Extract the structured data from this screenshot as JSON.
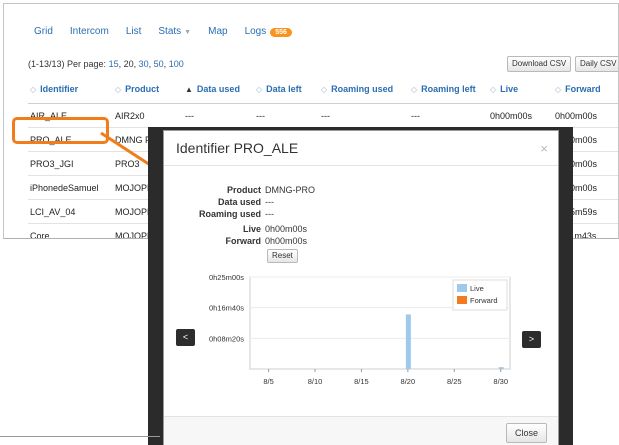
{
  "nav": {
    "grid": "Grid",
    "intercom": "Intercom",
    "list": "List",
    "stats": "Stats",
    "map": "Map",
    "logs": "Logs",
    "logs_count": "556"
  },
  "paging": {
    "summary": "(1-13/13) Per page: ",
    "options": [
      "15",
      "20",
      "30",
      "50",
      "100"
    ],
    "selected": "20"
  },
  "buttons": {
    "download_csv": "Download CSV",
    "daily_csv": "Daily CSV"
  },
  "table": {
    "headers": [
      "Identifier",
      "Product",
      "Data used",
      "Data left",
      "Roaming used",
      "Roaming left",
      "Live",
      "Forward"
    ],
    "rows": [
      [
        "AIR_ALE",
        "AIR2x0",
        "---",
        "---",
        "---",
        "---",
        "0h00m00s",
        "0h00m00s"
      ],
      [
        "PRO_ALE",
        "DMNG PRO",
        "",
        "",
        "",
        "",
        "0h00m00s",
        "0h00m00s"
      ],
      [
        "PRO3_JGI",
        "PRO3",
        "",
        "",
        "",
        "",
        "0h00m00s",
        "0h00m00s"
      ],
      [
        "iPhonedeSamuel",
        "MOJOPRO",
        "",
        "",
        "",
        "",
        "0h00m00s",
        "0h00m00s"
      ],
      [
        "LCI_AV_04",
        "MOJOPRO",
        "",
        "",
        "",
        "",
        "0h55m59s",
        "0h55m59s"
      ],
      [
        "Core",
        "MOJOPRO",
        "",
        "",
        "",
        "",
        "0h11m43s",
        "0h11m43s"
      ]
    ]
  },
  "modal": {
    "title": "Identifier PRO_ALE",
    "close_x": "×",
    "fields": [
      {
        "k": "Product",
        "v": "DMNG-PRO"
      },
      {
        "k": "Data used",
        "v": "---"
      },
      {
        "k": "Roaming used",
        "v": "---"
      },
      {
        "k": "Live",
        "v": "0h00m00s"
      },
      {
        "k": "Forward",
        "v": "0h00m00s"
      }
    ],
    "reset": "Reset",
    "close": "Close",
    "prev_arrow": "<",
    "next_arrow": ">"
  },
  "chart_data": {
    "type": "bar",
    "x_ticks": [
      "8/5",
      "8/10",
      "8/15",
      "8/20",
      "8/25",
      "8/30"
    ],
    "y_ticks": [
      "0h25m00s",
      "0h16m40s",
      "0h08m20s"
    ],
    "ylim_seconds": [
      0,
      1500
    ],
    "legend_position": "top-right",
    "series": [
      {
        "name": "Live",
        "color": "#9ec9ea",
        "points": [
          {
            "x": "8/20",
            "seconds": 890
          },
          {
            "x": "8/30",
            "seconds": 30
          }
        ]
      },
      {
        "name": "Forward",
        "color": "#f47a20",
        "points": []
      }
    ]
  }
}
